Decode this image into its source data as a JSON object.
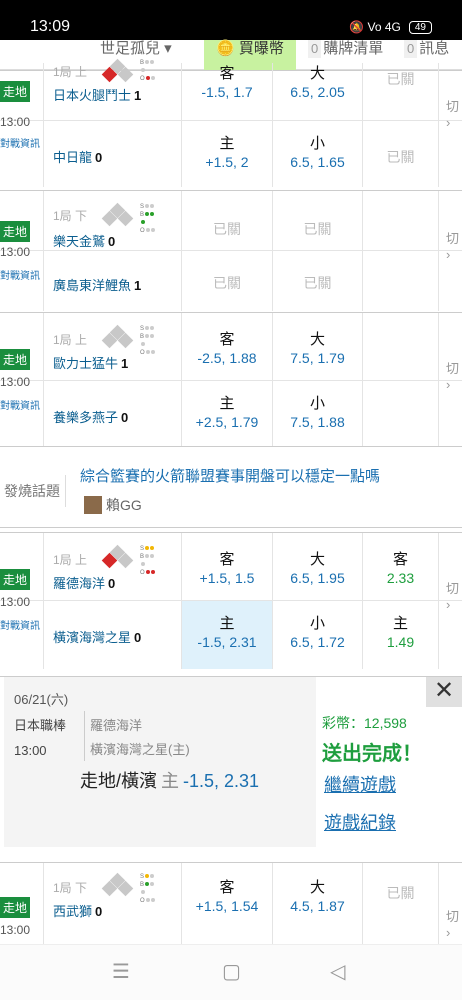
{
  "status": {
    "time": "13:09",
    "icons": "🔕 Vo 4G",
    "battery": "49"
  },
  "topnav": {
    "items": [
      "世足孤兒 ▾",
      "買曝幣"
    ],
    "cart_count": "0",
    "cart_label": "購牌清單",
    "msg_count": "0",
    "msg_label": "訊息"
  },
  "games": [
    {
      "status": "走地",
      "time": "13:00",
      "info": "對戰資訊",
      "inning": "1局 上",
      "away": {
        "name": "日本火腿鬥士",
        "score": "1"
      },
      "home": {
        "name": "中日龍",
        "score": "0"
      },
      "row1": [
        {
          "label": "客",
          "value": "-1.5, 1.7"
        },
        {
          "label": "大",
          "value": "6.5, 2.05"
        },
        {
          "closed": "已關"
        }
      ],
      "row2": [
        {
          "label": "主",
          "value": "+1.5, 2"
        },
        {
          "label": "小",
          "value": "6.5, 1.65"
        },
        {
          "closed": "已關"
        }
      ],
      "toggle": "切"
    },
    {
      "status": "走地",
      "time": "13:00",
      "info": "對戰資訊",
      "inning": "1局 下",
      "away": {
        "name": "樂天金鷲",
        "score": "0"
      },
      "home": {
        "name": "廣島東洋鯉魚",
        "score": "1"
      },
      "row1": [
        {
          "closed": "已關"
        },
        {
          "closed": "已關"
        }
      ],
      "row2": [
        {
          "closed": "已關"
        },
        {
          "closed": "已關"
        }
      ],
      "toggle": "切"
    },
    {
      "status": "走地",
      "time": "13:00",
      "info": "對戰資訊",
      "inning": "1局 上",
      "away": {
        "name": "歐力士猛牛",
        "score": "1"
      },
      "home": {
        "name": "養樂多燕子",
        "score": "0"
      },
      "row1": [
        {
          "label": "客",
          "value": "-2.5, 1.88"
        },
        {
          "label": "大",
          "value": "7.5, 1.79"
        }
      ],
      "row2": [
        {
          "label": "主",
          "value": "+2.5, 1.79"
        },
        {
          "label": "小",
          "value": "7.5, 1.88"
        }
      ],
      "toggle": "切"
    },
    {
      "status": "走地",
      "time": "13:00",
      "info": "對戰資訊",
      "inning": "1局 上",
      "away": {
        "name": "羅德海洋",
        "score": "0"
      },
      "home": {
        "name": "橫濱海灣之星",
        "score": "0"
      },
      "row1": [
        {
          "label": "客",
          "value": "+1.5, 1.5"
        },
        {
          "label": "大",
          "value": "6.5, 1.95"
        },
        {
          "label": "客",
          "value": "2.33"
        }
      ],
      "row2": [
        {
          "label": "主",
          "value": "-1.5, 2.31"
        },
        {
          "label": "小",
          "value": "6.5, 1.72"
        },
        {
          "label": "主",
          "value": "1.49"
        }
      ],
      "toggle": "切"
    },
    {
      "status": "走地",
      "time": "13:00",
      "info": "",
      "inning": "1局 下",
      "away": {
        "name": "西武獅",
        "score": "0"
      },
      "row1": [
        {
          "label": "客",
          "value": "+1.5, 1.54"
        },
        {
          "label": "大",
          "value": "4.5, 1.87"
        },
        {
          "closed": "已關"
        }
      ],
      "toggle": "切"
    }
  ],
  "topic": {
    "label": "發燒話題",
    "title": "綜合籃賽的火箭聯盟賽事開盤可以穩定一點嗎",
    "user": "賴GG"
  },
  "receipt": {
    "date": "06/21(六)",
    "league": "日本職棒",
    "time": "13:00",
    "team1": "羅德海洋",
    "team2": "橫濱海灣之星(主)",
    "bet": "走地/橫濱",
    "bet_side": "主",
    "bet_odds": "-1.5, 2.31",
    "coins": "彩幣：12,598",
    "done": "送出完成！",
    "continue": "繼續遊戲",
    "history": "遊戲紀錄",
    "close": "✕"
  },
  "bottom_nav": {
    "menu": "☰",
    "home": "▢",
    "back": "◁"
  }
}
